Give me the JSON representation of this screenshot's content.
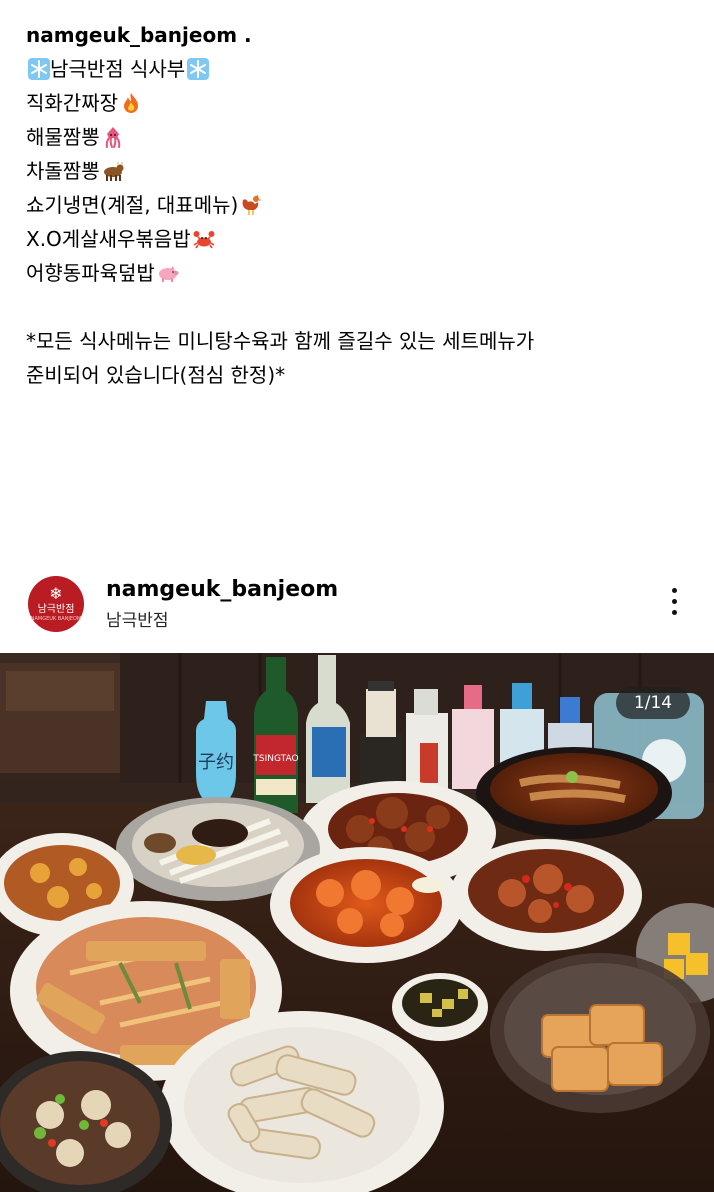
{
  "caption": {
    "username_line": "namgeuk_banjeom .",
    "title": "남극반점 식사부",
    "menu": [
      {
        "text": "직화간짜장",
        "icon": "fire-icon"
      },
      {
        "text": "해물짬뽕",
        "icon": "squid-icon"
      },
      {
        "text": "차돌짬뽕",
        "icon": "ox-icon"
      },
      {
        "text": "쇼기냉면(계절, 대표메뉴)",
        "icon": "rooster-icon"
      },
      {
        "text": "X.O게살새우볶음밥",
        "icon": "crab-icon"
      },
      {
        "text": "어향동파육덮밥",
        "icon": "pig-icon"
      }
    ],
    "note_line1": "*모든 식사메뉴는 미니탕수육과 함께 즐길수 있는 세트메뉴가",
    "note_line2": "준비되어 있습니다(점심 한정)*"
  },
  "post": {
    "username": "namgeuk_banjeom",
    "display_name": "남극반점",
    "avatar_text": "남극반점",
    "avatar_subtext": "NAMGEUK BANJEOM",
    "image_counter": "1/14",
    "bottle_labels": [
      "子约",
      "TSINGTAO"
    ]
  },
  "colors": {
    "brand_red": "#b91c22",
    "text": "#000000",
    "counter_bg": "#1e1e1e"
  }
}
